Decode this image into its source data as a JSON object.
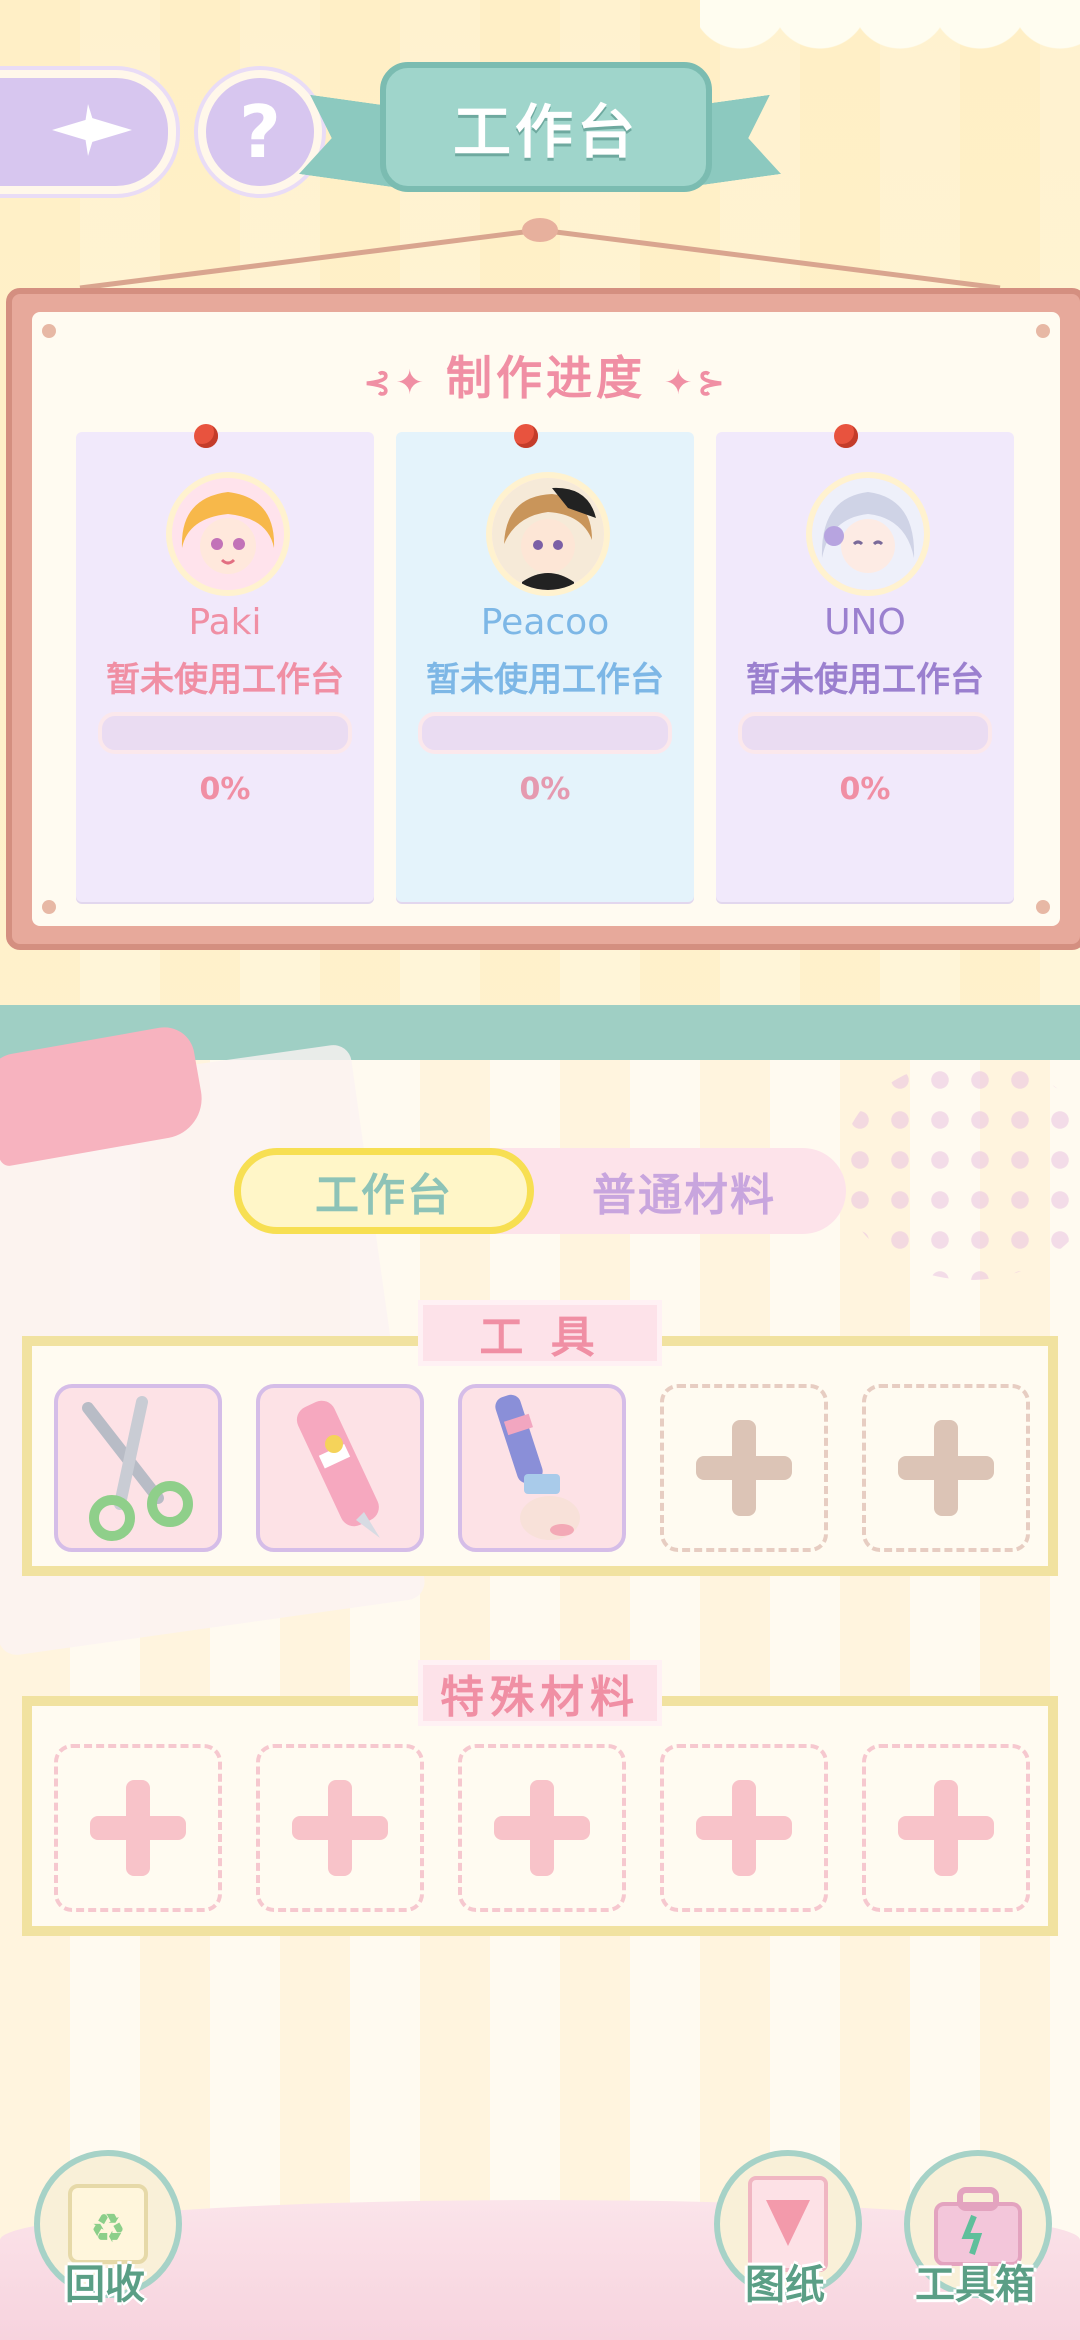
{
  "header": {
    "title": "工作台",
    "back_icon": "compass-arrow-icon",
    "help_icon": "question-icon"
  },
  "progress_board": {
    "title": "制作进度",
    "cards": [
      {
        "name": "Paki",
        "status": "暂未使用工作台",
        "progress": 0,
        "percent_text": "0%",
        "name_color": "#f08fa4",
        "bg": "#f1e9fb"
      },
      {
        "name": "Peacoo",
        "status": "暂未使用工作台",
        "progress": 0,
        "percent_text": "0%",
        "name_color": "#7db7e6",
        "bg": "#e4f3fb"
      },
      {
        "name": "UNO",
        "status": "暂未使用工作台",
        "progress": 0,
        "percent_text": "0%",
        "name_color": "#9b80cf",
        "bg": "#f1e9fb"
      }
    ]
  },
  "tabs": {
    "active": "工作台",
    "inactive": "普通材料"
  },
  "tools_section": {
    "title": "工 具",
    "slots": [
      "scissors-icon",
      "utility-knife-icon",
      "paintbrush-icon",
      "empty",
      "empty"
    ]
  },
  "special_section": {
    "title": "特殊材料",
    "slots": [
      "empty",
      "empty",
      "empty",
      "empty",
      "empty"
    ]
  },
  "bottom_bar": {
    "recycle": "回收",
    "blueprint": "图纸",
    "toolbox": "工具箱"
  },
  "colors": {
    "accent_pink": "#f08fa4",
    "teal": "#9fcfc4",
    "tab_highlight": "#f7df52"
  }
}
